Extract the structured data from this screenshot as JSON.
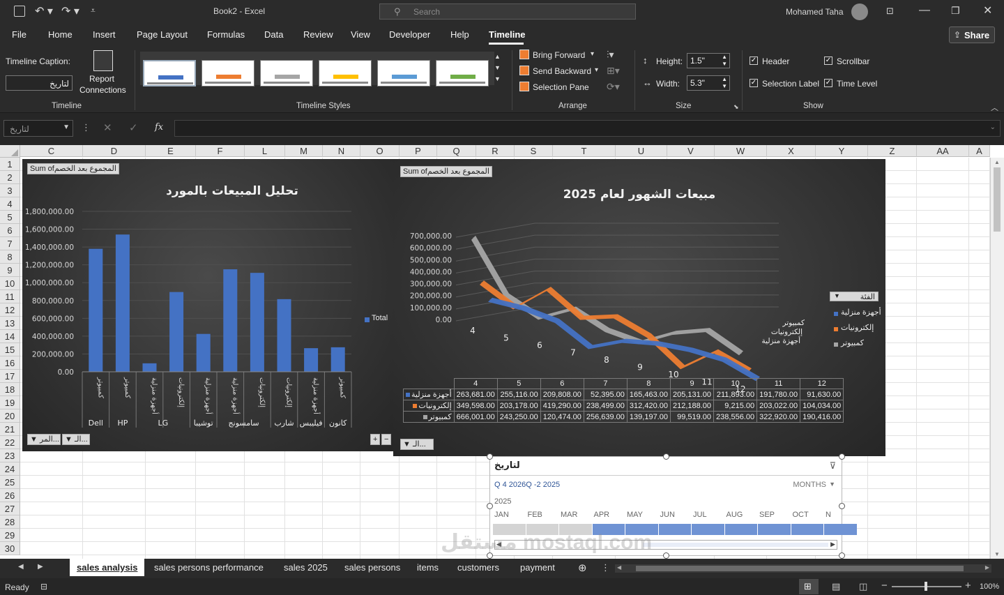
{
  "title_bar": {
    "doc_title": "Book2  -  Excel",
    "search_placeholder": "Search",
    "user_name": "Mohamed Taha"
  },
  "menu": {
    "items": [
      "File",
      "Home",
      "Insert",
      "Page Layout",
      "Formulas",
      "Data",
      "Review",
      "View",
      "Developer",
      "Help",
      "Timeline"
    ],
    "active": "Timeline",
    "share": "Share"
  },
  "ribbon": {
    "caption_label": "Timeline Caption:",
    "caption_value": "لتاريخ",
    "report_conn": [
      "Report",
      "Connections"
    ],
    "group_timeline": "Timeline",
    "group_styles": "Timeline Styles",
    "group_arrange": "Arrange",
    "group_size": "Size",
    "group_show": "Show",
    "bring_forward": "Bring Forward",
    "send_backward": "Send Backward",
    "selection_pane": "Selection Pane",
    "height_label": "Height:",
    "height_value": "1.5\"",
    "width_label": "Width:",
    "width_value": "5.3\"",
    "header": "Header",
    "selection_label": "Selection Label",
    "scrollbar": "Scrollbar",
    "time_level": "Time Level",
    "style_colors": [
      "#4472c4",
      "#ed7d31",
      "#a5a5a5",
      "#ffc000",
      "#5b9bd5",
      "#70ad47"
    ]
  },
  "formula": {
    "name_box": "لتاريخ",
    "fx": "fx"
  },
  "columns": [
    "C",
    "D",
    "E",
    "F",
    "L",
    "M",
    "N",
    "O",
    "P",
    "Q",
    "R",
    "S",
    "T",
    "U",
    "V",
    "W",
    "X",
    "Y",
    "Z",
    "AA",
    "A"
  ],
  "rows": [
    "1",
    "2",
    "3",
    "4",
    "5",
    "6",
    "7",
    "8",
    "9",
    "10",
    "11",
    "12",
    "13",
    "14",
    "15",
    "16",
    "17",
    "18",
    "19",
    "20",
    "21",
    "22",
    "23",
    "24",
    "25",
    "26",
    "27",
    "28",
    "29",
    "30"
  ],
  "chart_data": [
    {
      "type": "bar",
      "title": "تحليل المبيعات بالمورد",
      "field_button": "Sum ofالمجموع بعد الخصم",
      "legend": "Total",
      "ylim": [
        0,
        1800000
      ],
      "yticks": [
        "1,800,000.00",
        "1,600,000.00",
        "1,400,000.00",
        "1,200,000.00",
        "1,000,000.00",
        "800,000.00",
        "600,000.00",
        "400,000.00",
        "200,000.00",
        "0.00"
      ],
      "categories": [
        [
          "كمبيوتر",
          "Dell"
        ],
        [
          "كمبيوتر",
          "HP"
        ],
        [
          "أجهزة منزلية",
          "LG"
        ],
        [
          "إلكترونيات",
          "LG"
        ],
        [
          "أجهزة منزلية",
          "توشيبا"
        ],
        [
          "أجهزة منزلية",
          "سامسونج"
        ],
        [
          "إلكترونيات",
          "سامسونج"
        ],
        [
          "إلكترونيات",
          "شارب"
        ],
        [
          "أجهزة منزلية",
          "فيليبس"
        ],
        [
          "كمبيوتر",
          "كانون"
        ]
      ],
      "groups": [
        "Dell",
        "HP",
        "LG",
        "توشيبا",
        "سامسونج",
        "شارب",
        "فيليبس",
        "كانون"
      ],
      "values": [
        1380000,
        1540000,
        95000,
        895000,
        425000,
        1150000,
        1110000,
        815000,
        265000,
        275000
      ],
      "bottom_buttons": [
        "المر...",
        "الـ..."
      ]
    },
    {
      "type": "line",
      "title": "مبيعات الشهور لعام 2025",
      "field_button": "Sum ofالمجموع بعد الخصم",
      "yticks": [
        "700,000.00",
        "600,000.00",
        "500,000.00",
        "400,000.00",
        "300,000.00",
        "200,000.00",
        "100,000.00",
        "0.00"
      ],
      "ylim": [
        0,
        700000
      ],
      "x": [
        "4",
        "5",
        "6",
        "7",
        "8",
        "9",
        "10",
        "11",
        "12"
      ],
      "series": [
        {
          "name": "أجهزة منزلية",
          "color": "#4472c4",
          "values": [
            263681,
            255116,
            209808,
            52395,
            165463,
            205131,
            211893,
            191780,
            91630
          ],
          "labels": [
            "263,681.00",
            "255,116.00",
            "209,808.00",
            "52,395.00",
            "165,463.00",
            "205,131.00",
            "211,893.00",
            "191,780.00",
            "91,630.00"
          ]
        },
        {
          "name": "إلكترونيات",
          "color": "#ed7d31",
          "values": [
            349598,
            203178,
            419290,
            238499,
            312420,
            212188,
            9215,
            203022,
            104034
          ],
          "labels": [
            "349,598.00",
            "203,178.00",
            "419,290.00",
            "238,499.00",
            "312,420.00",
            "212,188.00",
            "9,215.00",
            "203,022.00",
            "104,034.00"
          ]
        },
        {
          "name": "كمبيوتر",
          "color": "#a5a5a5",
          "values": [
            666001,
            243250,
            120474,
            256639,
            139197,
            99519,
            238556,
            322920,
            190416
          ],
          "labels": [
            "666,001.00",
            "243,250.00",
            "120,474.00",
            "256,639.00",
            "139,197.00",
            "99,519.00",
            "238,556.00",
            "322,920.00",
            "190,416.00"
          ]
        }
      ],
      "legend_title": "الفئة",
      "bottom_button": "الـ..."
    }
  ],
  "timeline": {
    "caption": "لتاريخ",
    "selection": "Q 4 2026Q -2 2025",
    "level": "MONTHS",
    "year": "2025",
    "months": [
      "JAN",
      "FEB",
      "MAR",
      "APR",
      "MAY",
      "JUN",
      "JUL",
      "AUG",
      "SEP",
      "OCT",
      "N"
    ]
  },
  "sheets": {
    "tabs": [
      "sales analysis",
      "sales persons performance",
      "sales 2025",
      "sales persons",
      "items",
      "customers",
      "payment ..."
    ],
    "active": "sales analysis"
  },
  "status": {
    "ready": "Ready",
    "zoom": "100%"
  },
  "watermark": "مستقل mostaql.com"
}
